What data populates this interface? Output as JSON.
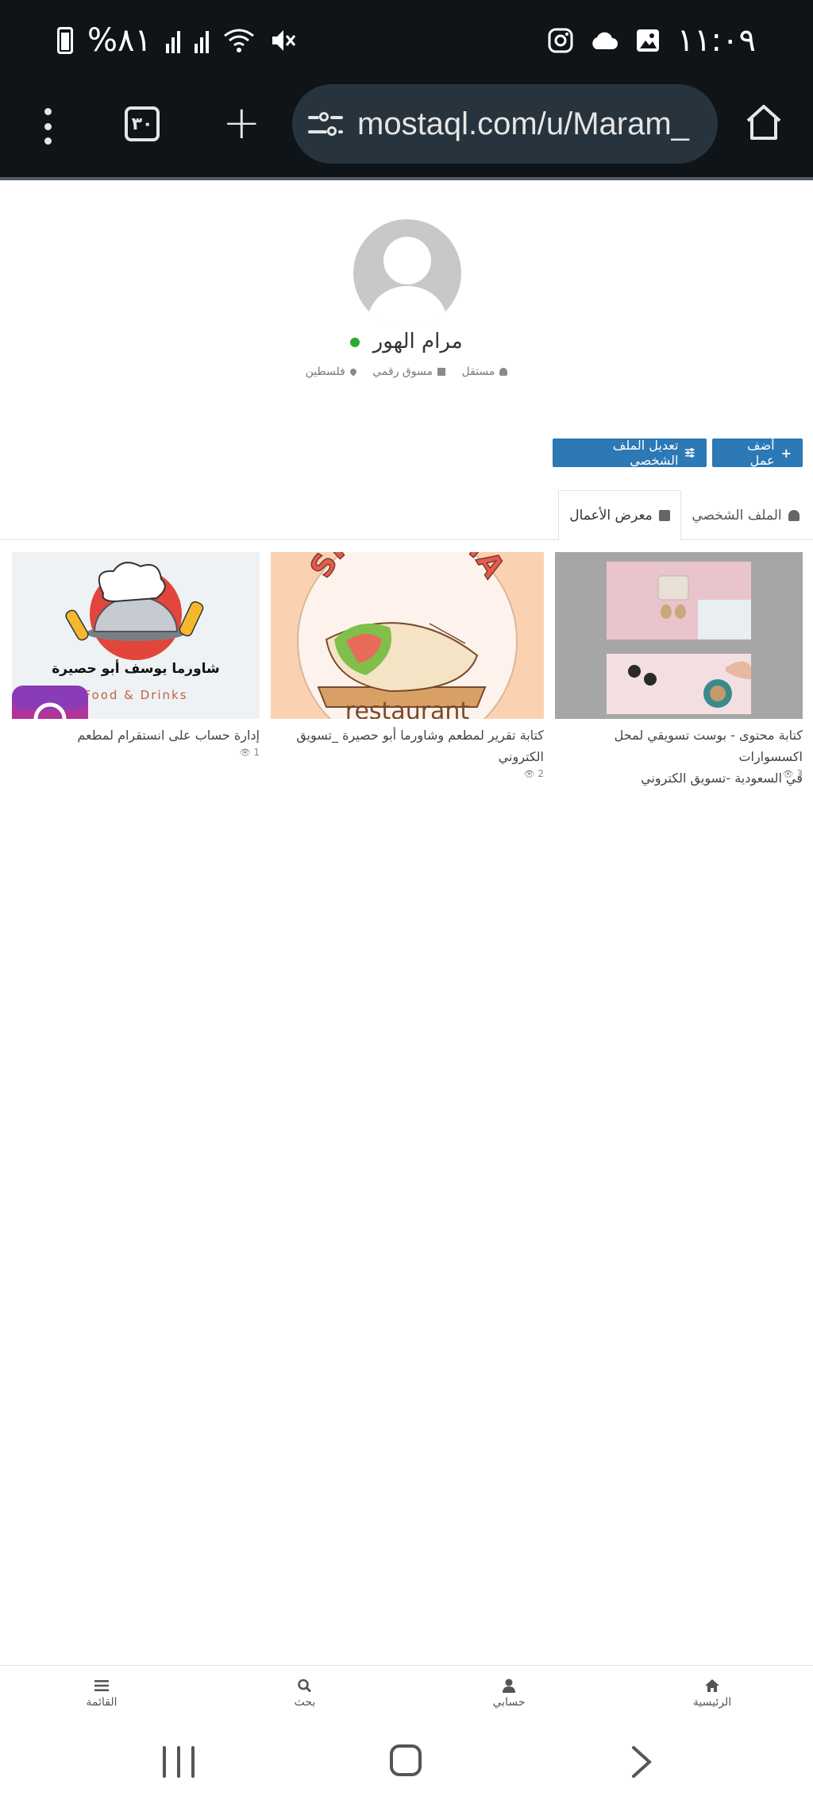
{
  "status_bar": {
    "time": "١١:٠٩",
    "battery": "%٨١"
  },
  "browser": {
    "tab_count": "٣٠",
    "url": "mostaql.com/u/Maram_"
  },
  "profile": {
    "name": "مرام الهور",
    "online": true,
    "meta": {
      "role": "مستقل",
      "specialty": "مسوق رقمي",
      "location": "فلسطين"
    }
  },
  "actions": {
    "add_work": "أضف عمل",
    "edit_profile": "تعديل الملف الشخصي"
  },
  "tabs": [
    {
      "label": "الملف الشخصي",
      "active": false
    },
    {
      "label": "معرض الأعمال",
      "active": true
    }
  ],
  "portfolio": [
    {
      "title_line1": "كتابة محتوى - بوست تسويقي لمحل اكسسوارات",
      "title_line2": "في السعودية -تسويق الكتروني",
      "views": "3"
    },
    {
      "title_line1": "كتابة تقرير لمطعم وشاورما أبو حصيرة _تسويق",
      "title_line2": "الكتروني",
      "views": "2",
      "thumb_text": "SHAWARMA",
      "thumb_subtext": "restaurant"
    },
    {
      "title_line1": "إدارة حساب على انستقرام لمطعم",
      "views": "1",
      "thumb_text": "شاورما يوسف أبو حصيرة",
      "thumb_subtext": "Food & Drinks"
    }
  ],
  "bottom_nav": {
    "home": "الرئيسية",
    "account": "حسابي",
    "search": "بحث",
    "menu": "القائمة"
  },
  "colors": {
    "primary": "#2c79b6",
    "online": "#2eaa2e",
    "browser_bg": "#0f1419",
    "url_bg": "#27343d"
  }
}
